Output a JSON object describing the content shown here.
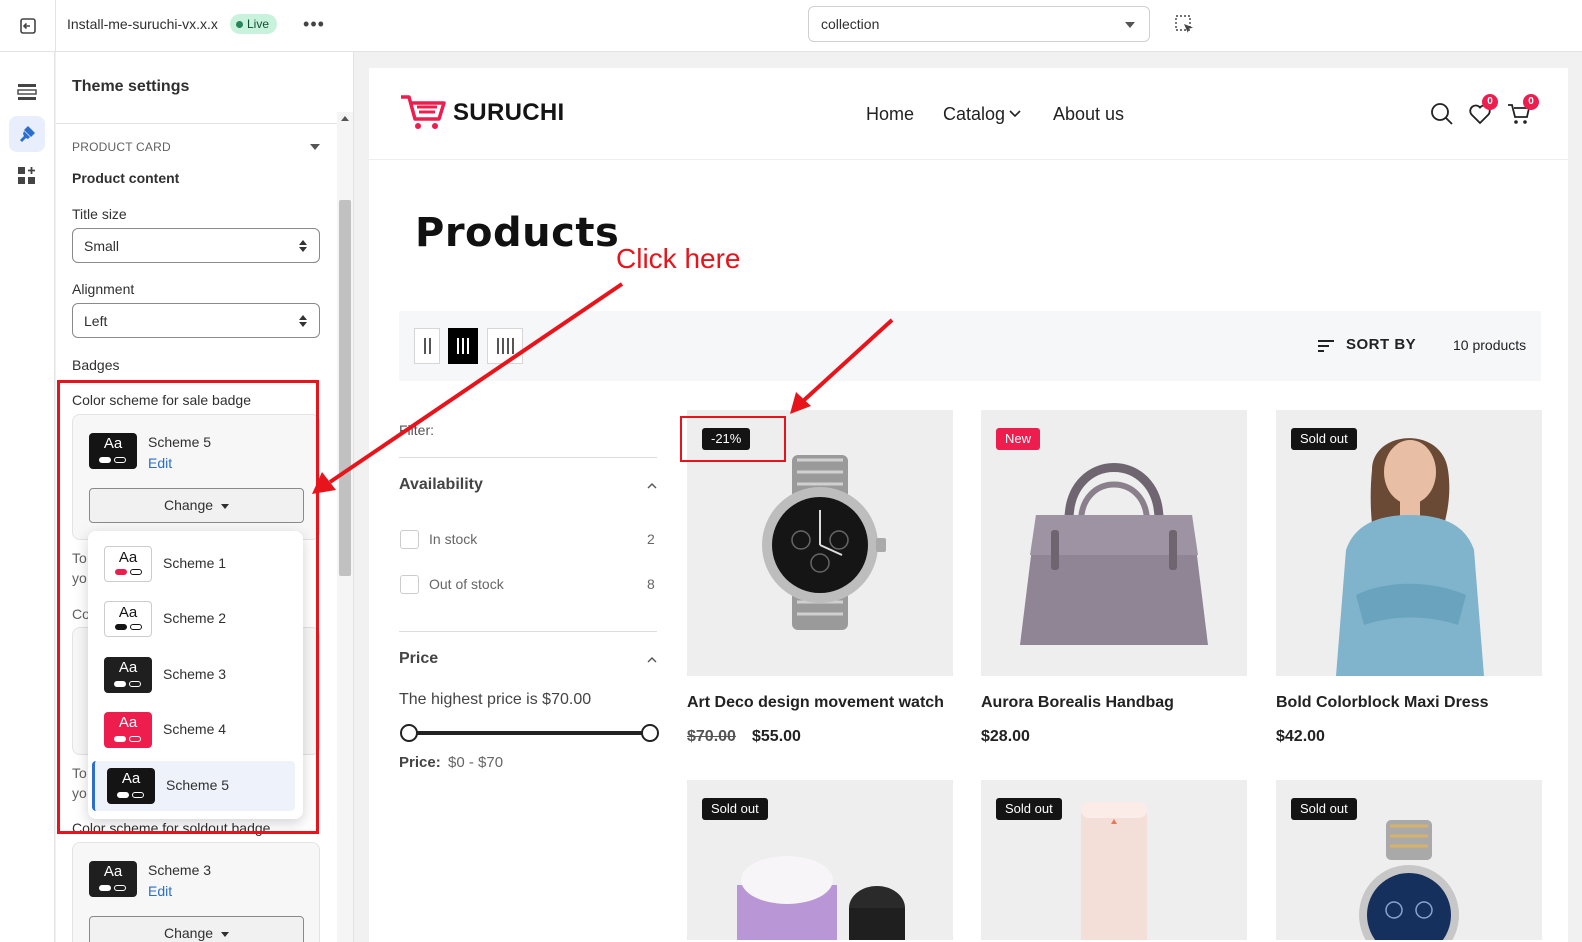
{
  "topbar": {
    "theme_name": "Install-me-suruchi-vx.x.x",
    "live_label": "Live",
    "more_label": "•••",
    "page_select_value": "collection"
  },
  "panel": {
    "title": "Theme settings",
    "section_heading": "PRODUCT CARD",
    "product_content_label": "Product content",
    "title_size_label": "Title size",
    "title_size_value": "Small",
    "alignment_label": "Alignment",
    "alignment_value": "Left",
    "badges_label": "Badges",
    "sale_badge_label": "Color scheme for sale badge",
    "sale_badge_scheme": "Scheme 5",
    "edit_label": "Edit",
    "change_label": "Change",
    "frag_to": "To",
    "frag_yo": "yo",
    "frag_co": "Co",
    "soldout_label": "Color scheme for soldout badge",
    "soldout_scheme": "Scheme 3",
    "swatch_text": "Aa"
  },
  "dropdown": {
    "options": [
      {
        "name": "Scheme 1",
        "bg": "#ffffff",
        "fg": "#141414",
        "pill1": "#ed1d4e",
        "pill2": "#ffffff"
      },
      {
        "name": "Scheme 2",
        "bg": "#ffffff",
        "fg": "#141414",
        "pill1": "#141414",
        "pill2": "#ffffff"
      },
      {
        "name": "Scheme 3",
        "bg": "#1f1f1f",
        "fg": "#ffffff",
        "pill1": "#ffffff",
        "pill2": "#1f1f1f"
      },
      {
        "name": "Scheme 4",
        "bg": "#ed1d4e",
        "fg": "#ffffff",
        "pill1": "#ffffff",
        "pill2": "#ed1d4e"
      },
      {
        "name": "Scheme 5",
        "bg": "#141414",
        "fg": "#ffffff",
        "pill1": "#ffffff",
        "pill2": "#141414"
      }
    ],
    "selected": "Scheme 5"
  },
  "store": {
    "logo": "SURUCHI",
    "nav": [
      "Home",
      "Catalog",
      "About us"
    ],
    "wishlist_count": "0",
    "cart_count": "0",
    "page_title": "Products",
    "sort_label": "SORT BY",
    "product_count": "10 products",
    "filter_label": "Filter:",
    "availability_title": "Availability",
    "in_stock_label": "In stock",
    "in_stock_count": "2",
    "out_of_stock_label": "Out of stock",
    "out_of_stock_count": "8",
    "price_title": "Price",
    "price_note": "The highest price is $70.00",
    "price_range_label": "Price:",
    "price_range_value": "$0 - $70",
    "products": [
      {
        "title": "Art Deco design movement watch",
        "badge": "-21%",
        "compare_price": "$70.00",
        "price": "$55.00"
      },
      {
        "title": "Aurora Borealis Handbag",
        "badge": "New",
        "price": "$28.00"
      },
      {
        "title": "Bold Colorblock Maxi Dress",
        "badge": "Sold out",
        "price": "$42.00"
      },
      {
        "badge": "Sold out"
      },
      {
        "badge": "Sold out"
      },
      {
        "badge": "Sold out"
      }
    ]
  },
  "annotation": {
    "text": "Click here",
    "color": "#e8141b"
  },
  "colors": {
    "accent_blue": "#2c6ecb",
    "brand_pink": "#ed1d4e",
    "live_green_bg": "#c9f2dd"
  }
}
